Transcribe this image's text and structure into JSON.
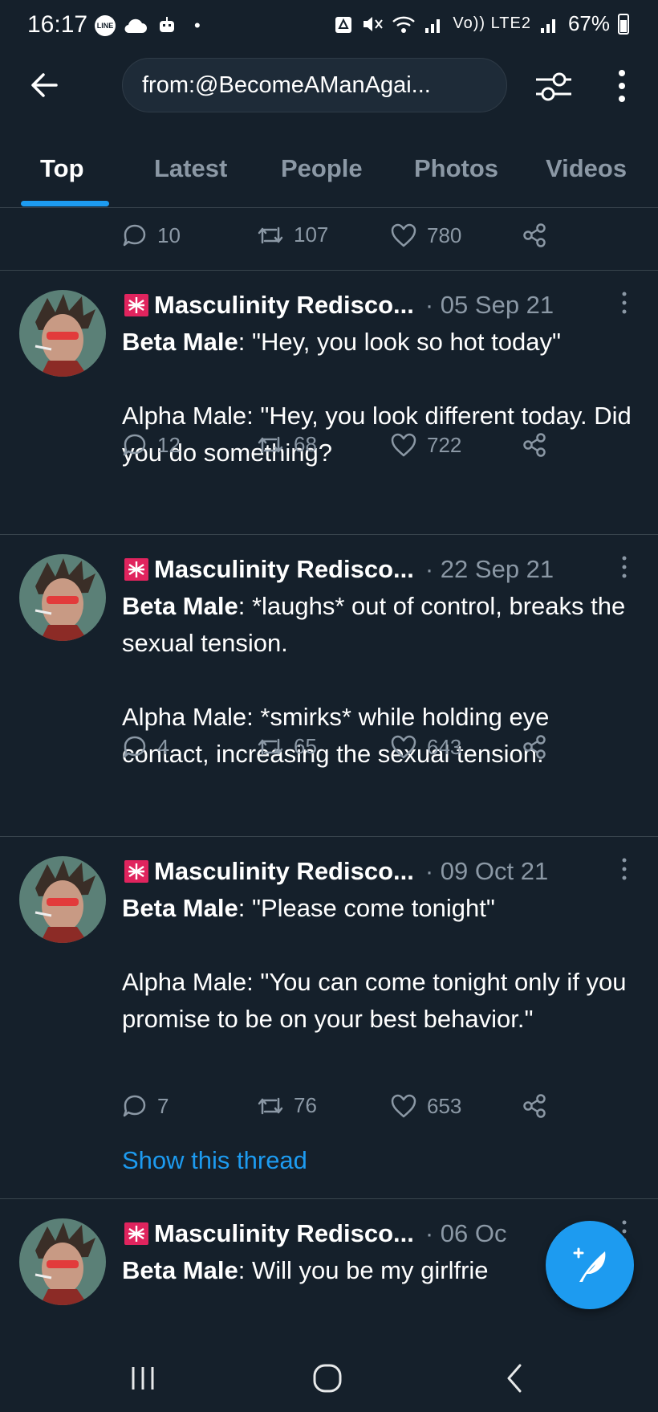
{
  "status_bar": {
    "time": "16:17",
    "left_icons": [
      "line-icon",
      "cloud-icon",
      "robot-icon"
    ],
    "network_label": "Vo)) LTE2",
    "battery": "67%",
    "battery_level": 0.67
  },
  "header": {
    "search_value": "from:@BecomeAManAgai..."
  },
  "tabs": [
    {
      "label": "Top",
      "active": true
    },
    {
      "label": "Latest"
    },
    {
      "label": "People"
    },
    {
      "label": "Photos"
    },
    {
      "label": "Videos"
    }
  ],
  "top_actions": {
    "replies": "10",
    "retweets": "107",
    "likes": "780"
  },
  "tweets": [
    {
      "name": "Masculinity Redisco...",
      "date": "· 05 Sep 21",
      "line1_bold": "Beta Male",
      "line1_rest": ": \"Hey, you look so hot today\"",
      "para2": "Alpha Male: \"Hey, you look different today. Did you do something?",
      "replies": "12",
      "retweets": "68",
      "likes": "722"
    },
    {
      "name": "Masculinity Redisco...",
      "date": "· 22 Sep 21",
      "line1_bold": "Beta Male",
      "line1_rest": ": *laughs* out of control, breaks the sexual tension.",
      "para2": "Alpha Male: *smirks* while holding eye contact, increasing the sexual tension.",
      "replies": "4",
      "retweets": "65",
      "likes": "643"
    },
    {
      "name": "Masculinity Redisco...",
      "date": "· 09 Oct 21",
      "line1_bold": "Beta Male",
      "line1_rest": ": \"Please come tonight\"",
      "para2": "Alpha Male: \"You can come tonight only if you promise to be on your best behavior.\"",
      "replies": "7",
      "retweets": "76",
      "likes": "653",
      "thread_link": "Show this thread"
    },
    {
      "name": "Masculinity Redisco...",
      "date": "· 06 Oc",
      "line1_bold": "Beta Male",
      "line1_rest": ":  Will you be my girlfrie"
    }
  ],
  "colors": {
    "background": "#15202b",
    "accent": "#1d9bf0",
    "muted": "#8b98a5",
    "divider": "#38444d",
    "siren": "#e0245e"
  }
}
